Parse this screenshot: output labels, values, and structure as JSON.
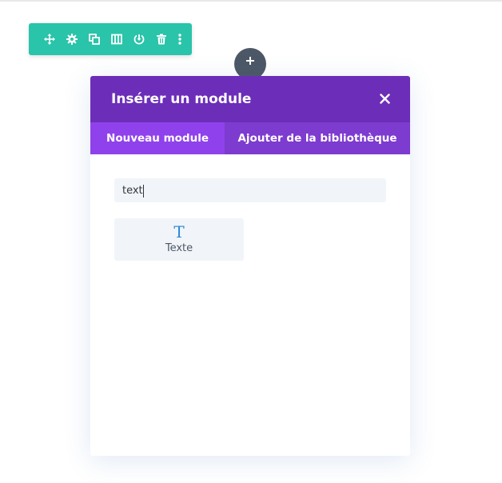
{
  "row_toolbar": {
    "accent": "#29c4a9",
    "buttons": [
      {
        "icon": "move-icon"
      },
      {
        "icon": "gear-icon"
      },
      {
        "icon": "duplicate-icon"
      },
      {
        "icon": "columns-icon"
      },
      {
        "icon": "save-icon"
      },
      {
        "icon": "trash-icon"
      },
      {
        "icon": "more-icon"
      }
    ]
  },
  "add_button": {
    "icon": "plus-icon",
    "color": "#4c5866"
  },
  "modal": {
    "title": "Insérer un module",
    "close_icon": "close-icon",
    "header_color": "#6c2eb9",
    "tabs": [
      {
        "label": "Nouveau module",
        "active": true
      },
      {
        "label": "Ajouter de la bibliothèque",
        "active": false
      }
    ],
    "search": {
      "value": "text",
      "placeholder": ""
    },
    "results": [
      {
        "icon": "text-icon",
        "glyph": "T",
        "label": "Texte"
      }
    ]
  }
}
